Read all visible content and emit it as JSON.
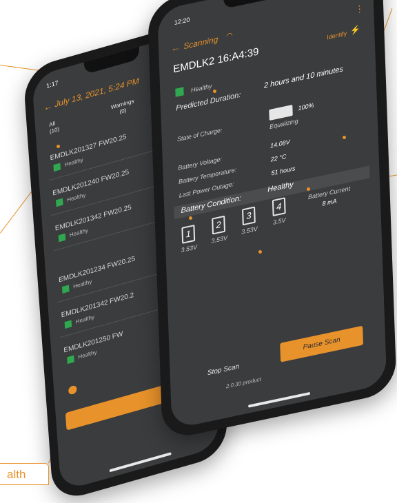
{
  "back_screen": {
    "time": "1:17",
    "date_title": "July 13, 2021, 5:24 PM",
    "tabs": [
      {
        "label": "All",
        "count": "(10)"
      },
      {
        "label": "Warnings",
        "count": "(0)"
      }
    ],
    "devices": [
      {
        "name": "EMDLK201327 FW20.25",
        "status": "Healthy"
      },
      {
        "name": "EMDLK201240 FW20.25",
        "status": "Healthy"
      },
      {
        "name": "EMDLK201342 FW20.25",
        "status": "Healthy"
      },
      {
        "name": "EMDLK201234 FW20.25",
        "status": "Healthy"
      },
      {
        "name": "EMDLK201342 FW20.2",
        "status": "Healthy"
      },
      {
        "name": "EMDLK201250 FW",
        "status": "Healthy"
      }
    ]
  },
  "front_screen": {
    "time": "12:20",
    "nav_title": "Scanning",
    "device_name": "EMDLK2 16:A4:39",
    "identify_label": "Identify",
    "status": "Healthy",
    "predicted_label": "Predicted Duration:",
    "predicted_value": "2 hours and 10 minutes",
    "soc_label": "State of Charge:",
    "soc_value": "100%",
    "soc_state": "Equalizing",
    "voltage_label": "Battery Voltage:",
    "voltage_value": "14.08V",
    "temp_label": "Battery Temperature:",
    "temp_value": "22 °C",
    "outage_label": "Last Power Outage:",
    "outage_value": "51 hours",
    "condition_label": "Battery Condition:",
    "condition_value": "Healthy",
    "cells": [
      {
        "num": "1",
        "voltage": "3.53V"
      },
      {
        "num": "2",
        "voltage": "3.53V"
      },
      {
        "num": "3",
        "voltage": "3.53V"
      },
      {
        "num": "4",
        "voltage": "3.5V"
      }
    ],
    "current_label": "Battery Current",
    "current_value": "8 mA",
    "stop_label": "Stop Scan",
    "pause_label": "Pause Scan",
    "version": "2.0.30 product"
  },
  "caption": {
    "text": "alth"
  },
  "colors": {
    "accent": "#e8922b",
    "healthy": "#2fa84f",
    "screen_bg": "#3a3c3e"
  }
}
